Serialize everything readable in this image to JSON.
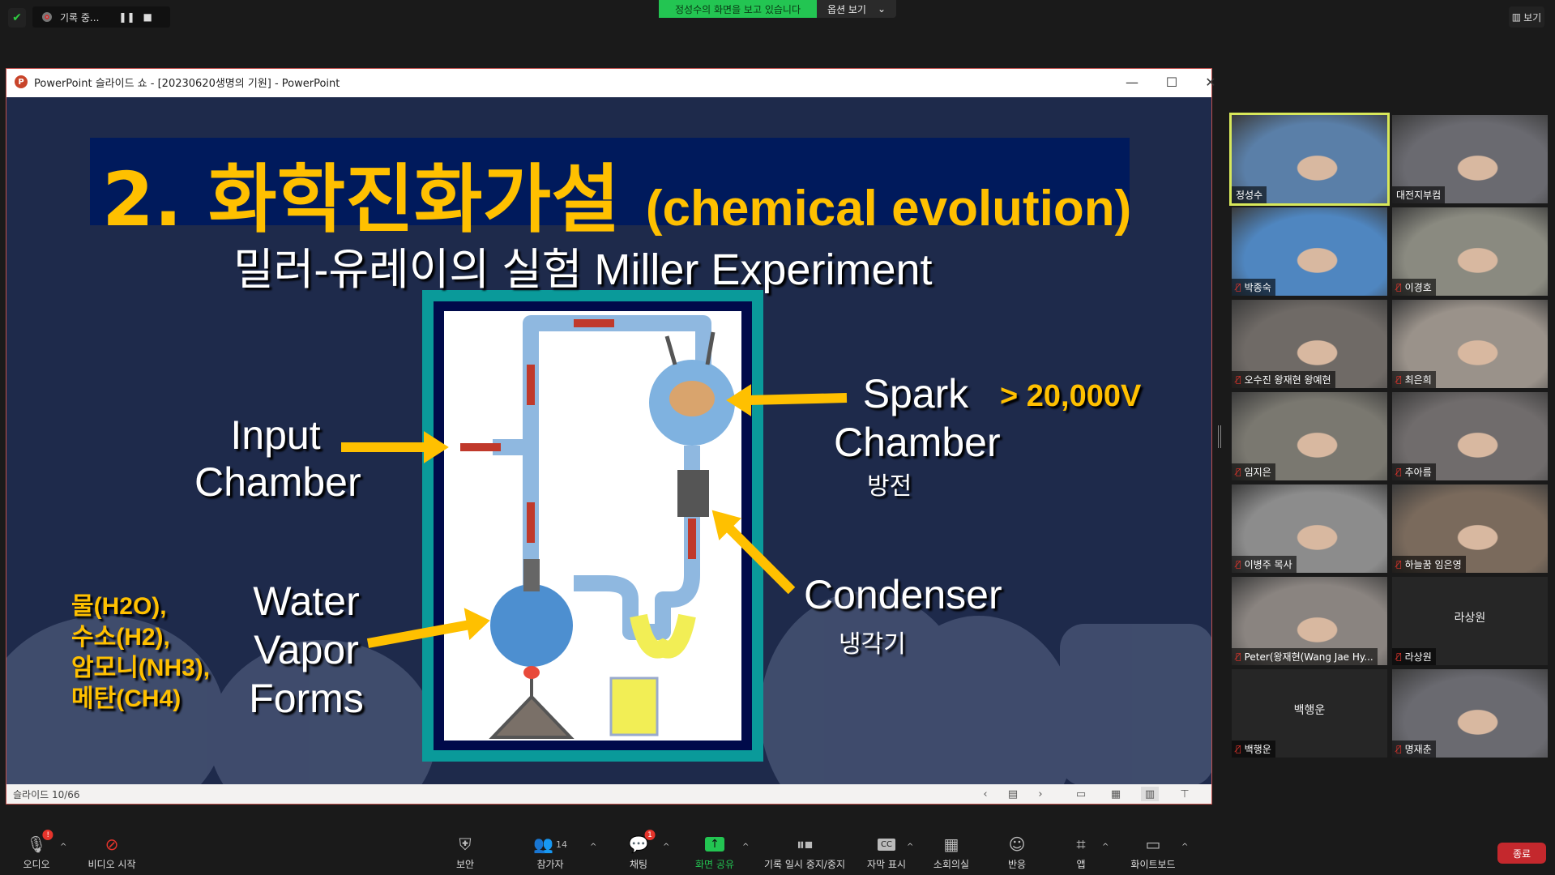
{
  "topbar": {
    "recording_label": "기록 중...",
    "viewing_banner": "정성수의 화면을 보고 있습니다",
    "options_label": "옵션 보기",
    "view_label": "보기"
  },
  "ppt": {
    "window_title": "PowerPoint 슬라이드 쇼 - [20230620생명의 기원] - PowerPoint",
    "slide_counter": "슬라이드 10/66"
  },
  "slide": {
    "title_ko": "2. 화학진화가설 ",
    "title_en": "(chemical evolution)",
    "subtitle": "밀러-유레이의 실험 Miller Experiment",
    "input_line1": "Input",
    "input_line2": "Chamber",
    "spark_line1": "Spark",
    "spark_line2": "Chamber",
    "spark_ko": "방전",
    "voltage": "> 20,000V",
    "condenser": "Condenser",
    "condenser_ko": "냉각기",
    "water_line1": "Water",
    "water_line2": "Vapor",
    "water_line3": "Forms",
    "chemicals": [
      "물(H2O),",
      "수소(H2),",
      "암모니(NH3),",
      "메탄(CH4)"
    ]
  },
  "participants": [
    {
      "name": "정성수",
      "muted": false,
      "video": true,
      "active": true,
      "color": "#5a7fa8"
    },
    {
      "name": "대전지부컴",
      "muted": false,
      "video": true,
      "color": "#6a6a70"
    },
    {
      "name": "박종숙",
      "muted": true,
      "video": true,
      "color": "#4f86c0"
    },
    {
      "name": "이경호",
      "muted": true,
      "video": true,
      "color": "#8a8a80"
    },
    {
      "name": "오수진 왕재현 왕예현",
      "muted": true,
      "video": true,
      "color": "#6f6a66"
    },
    {
      "name": "최은희",
      "muted": true,
      "video": true,
      "color": "#9a928a"
    },
    {
      "name": "임지은",
      "muted": true,
      "video": true,
      "color": "#7a7870"
    },
    {
      "name": "추아름",
      "muted": true,
      "video": true,
      "color": "#706c6c"
    },
    {
      "name": "이병주 목사",
      "muted": true,
      "video": true,
      "color": "#8c8c8c"
    },
    {
      "name": "하늘꿈 임은영",
      "muted": true,
      "video": true,
      "color": "#7a6a5c"
    },
    {
      "name": "Peter(왕재현(Wang Jae Hy...",
      "muted": true,
      "video": true,
      "color": "#8a8480"
    },
    {
      "name": "라상원",
      "muted": true,
      "video": false
    },
    {
      "name": "백행운",
      "muted": true,
      "video": false
    },
    {
      "name": "명재춘",
      "muted": true,
      "video": true,
      "color": "#6a6a70"
    }
  ],
  "toolbar": {
    "audio": "오디오",
    "video": "비디오 시작",
    "security": "보안",
    "participants": "참가자",
    "participant_count": "14",
    "chat": "채팅",
    "chat_badge": "1",
    "audio_badge": "!",
    "share": "화면 공유",
    "record": "기록 일시 중지/중지",
    "captions": "자막 표시",
    "breakout": "소회의실",
    "reactions": "반응",
    "apps": "앱",
    "whiteboard": "화이트보드",
    "end": "종료"
  },
  "colors": {
    "share_green": "#23c552",
    "end_red": "#c4282d",
    "slide_yellow": "#ffc000",
    "active_speaker": "#d8e85a"
  }
}
